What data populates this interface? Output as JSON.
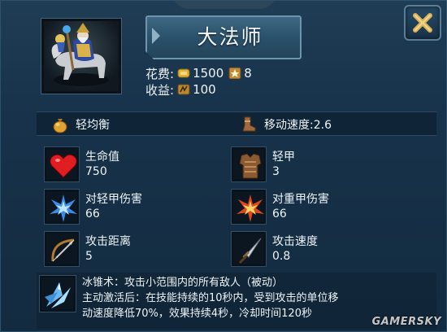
{
  "unit": {
    "name": "大法师",
    "cost_label": "花费:",
    "gold_cost": "1500",
    "supply_cost": "8",
    "income_label": "收益:",
    "income": "100"
  },
  "traits": {
    "armor_weight": "轻均衡",
    "move_speed": "移动速度:2.6"
  },
  "stats": [
    {
      "label": "生命值",
      "value": "750",
      "icon": "heart-icon"
    },
    {
      "label": "轻甲",
      "value": "3",
      "icon": "armor-icon"
    },
    {
      "label": "对轻甲伤害",
      "value": "66",
      "icon": "ice-burst-icon"
    },
    {
      "label": "对重甲伤害",
      "value": "66",
      "icon": "fire-burst-icon"
    },
    {
      "label": "攻击距离",
      "value": "5",
      "icon": "bow-icon"
    },
    {
      "label": "攻击速度",
      "value": "0.8",
      "icon": "dagger-icon"
    }
  ],
  "ability": {
    "line1": "冰锥术：攻击小范围内的所有敌人（被动）",
    "line2": "主动激活后：在技能持续的10秒内，受到攻击的单位移",
    "line3": "动速度降低70%，效果持续4秒，冷却时间120秒"
  },
  "watermark": "GAMERSKY",
  "colors": {
    "panel_bg": "#17324a",
    "title_plate": "#2a5069",
    "close_x": "#d8b25a",
    "text": "#eef4f8"
  }
}
